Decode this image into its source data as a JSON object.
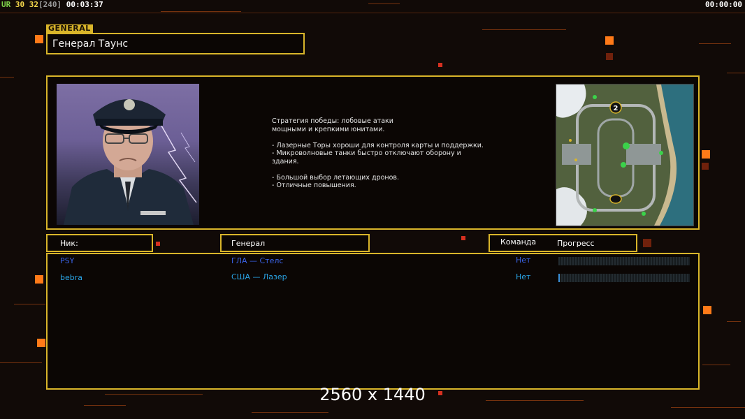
{
  "hud": {
    "brand": "UR",
    "fps": "30",
    "fps2": "32",
    "cap": "[240]",
    "elapsed": "00:03:37",
    "timer": "00:00:00"
  },
  "general_tag": "GENERAL",
  "general_name": "Генерал Таунс",
  "strategy_text": "Стратегия победы: лобовые атаки\nмощными и крепкими юнитами.\n\n- Лазерные Торы хороши для контроля карты и поддержки.\n- Микроволновые танки быстро отключают оборону и\n  здания.\n\n- Большой выбор летающих дронов.\n- Отличные повышения.",
  "minimap": {
    "marker": "2"
  },
  "columns": {
    "nick": "Ник:",
    "general": "Генерал",
    "team": "Команда",
    "progress": "Прогресс"
  },
  "players": [
    {
      "nick": "PSY",
      "general": "ГЛА — Стелс",
      "team": "Нет",
      "progress": 0.0,
      "color": "#3a63e6"
    },
    {
      "nick": "bebra",
      "general": "США — Лазер",
      "team": "Нет",
      "progress": 0.01,
      "color": "#2aa5e6"
    }
  ],
  "resolution": "2560 x 1440",
  "colors": {
    "frame": "#d9b52a",
    "accent": "#ff7a18"
  }
}
